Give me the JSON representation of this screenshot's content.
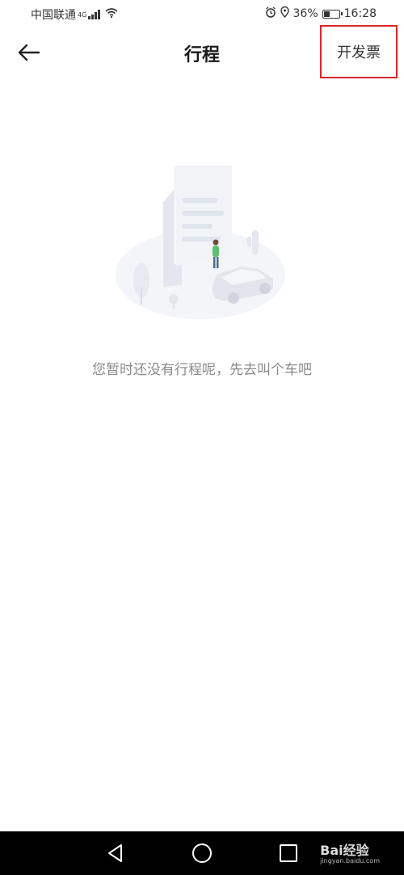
{
  "status_bar": {
    "carrier": "中国联通",
    "network": "4G",
    "battery": "36%",
    "battery_level": 0.36,
    "time": "16:28"
  },
  "header": {
    "title": "行程",
    "invoice_label": "开发票",
    "highlight_color": "#d9262b"
  },
  "empty_state": {
    "message": "您暂时还没有行程呢，先去叫个车吧"
  },
  "watermark": {
    "brand": "Bai经验",
    "url": "jingyan.baidu.com"
  },
  "icons": [
    "back-arrow-icon",
    "alarm-icon",
    "location-icon",
    "battery-icon",
    "wifi-icon",
    "signal-icon",
    "nav-back-icon",
    "nav-home-icon",
    "nav-recents-icon"
  ]
}
